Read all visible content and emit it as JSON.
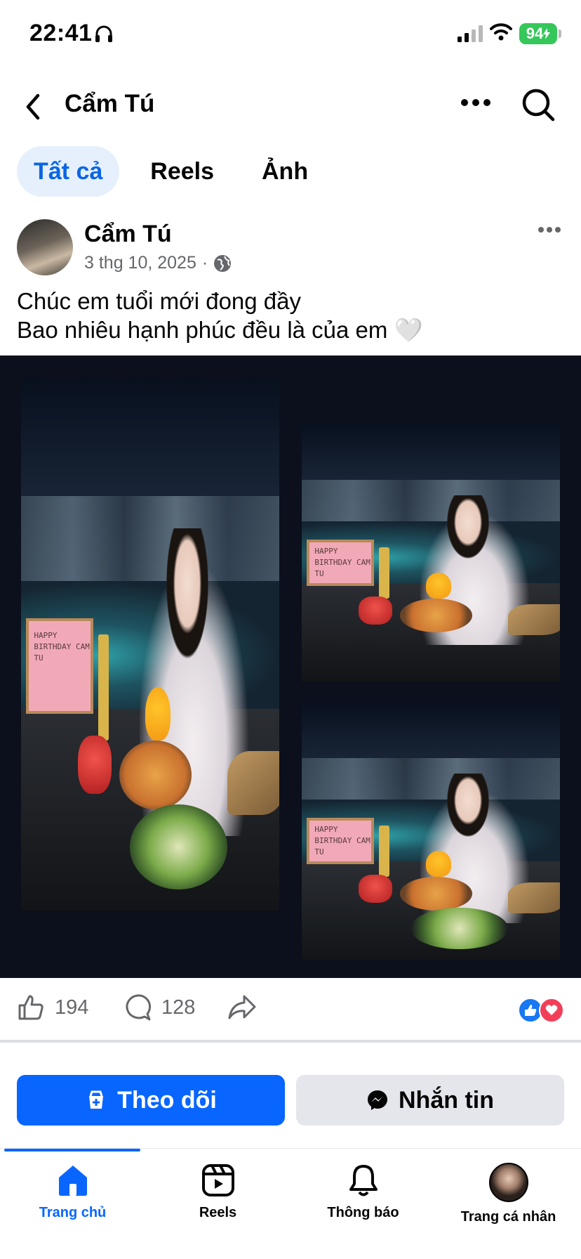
{
  "status_bar": {
    "time": "22:41",
    "battery": "94"
  },
  "header": {
    "title": "Cẩm Tú"
  },
  "tabs": [
    {
      "label": "Tất cả",
      "active": true
    },
    {
      "label": "Reels",
      "active": false
    },
    {
      "label": "Ảnh",
      "active": false
    }
  ],
  "post": {
    "author": "Cẩm Tú",
    "date": "3 thg 10, 2025",
    "separator": "·",
    "caption_line1": "Chúc em tuổi mới đong đầy",
    "caption_line2": "Bao nhiêu hạnh phúc đều là của em 🤍",
    "photo_sign_text": "HAPPY BIRTHDAY CAM TU",
    "likes": "194",
    "comments": "128"
  },
  "buttons": {
    "follow": "Theo dõi",
    "message": "Nhắn tin"
  },
  "bottom_nav": {
    "home": "Trang chủ",
    "reels": "Reels",
    "notifications": "Thông báo",
    "profile": "Trang cá nhân"
  },
  "colors": {
    "accent": "#0866ff",
    "tab_active_bg": "#e6f0fc",
    "battery": "#35c759",
    "media_bg": "#0b101c"
  }
}
